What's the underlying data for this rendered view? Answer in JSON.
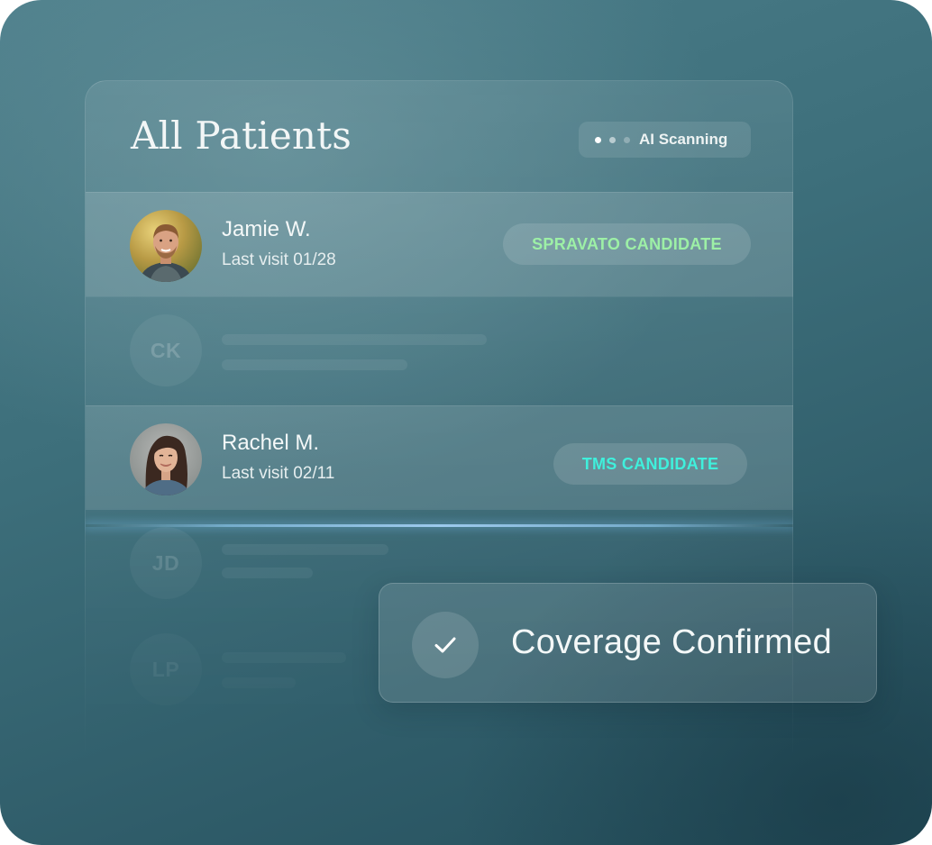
{
  "panel": {
    "title": "All Patients",
    "scanning_label": "AI Scanning"
  },
  "patients": [
    {
      "name": "Jamie W.",
      "last_visit": "Last visit 01/28",
      "badge": "SPRAVATO CANDIDATE",
      "badge_color": "#9df0a6",
      "photo": "man-smiling-photo"
    },
    {
      "initials": "CK"
    },
    {
      "name": "Rachel M.",
      "last_visit": "Last visit 02/11",
      "badge": "TMS CANDIDATE",
      "badge_color": "#3ff0dc",
      "photo": "woman-smiling-photo"
    },
    {
      "initials": "JD"
    },
    {
      "initials": "LP"
    }
  ],
  "toast": {
    "label": "Coverage Confirmed",
    "icon": "checkmark-icon"
  },
  "colors": {
    "background": "#3d6f7b",
    "accent_green": "#9df0a6",
    "accent_cyan": "#3ff0dc",
    "scan_line": "#aad7ff"
  }
}
